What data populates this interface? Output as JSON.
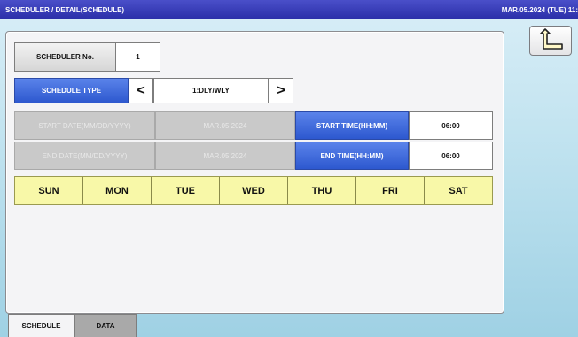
{
  "titlebar": {
    "title": "SCHEDULER / DETAIL(SCHEDULE)",
    "datetime": "MAR.05.2024 (TUE) 11:"
  },
  "scheduler_no": {
    "label": "SCHEDULER No.",
    "value": "1"
  },
  "schedule_type": {
    "label": "SCHEDULE TYPE",
    "prev": "<",
    "value": "1:DLY/WLY",
    "next": ">"
  },
  "start_date": {
    "label": "START DATE(MM/DD/YYYY)",
    "value": "MAR.05.2024"
  },
  "end_date": {
    "label": "END DATE(MM/DD/YYYY)",
    "value": "MAR.05.2024"
  },
  "start_time": {
    "label": "START TIME(HH:MM)",
    "value": "06:00"
  },
  "end_time": {
    "label": "END TIME(HH:MM)",
    "value": "06:00"
  },
  "days": [
    "SUN",
    "MON",
    "TUE",
    "WED",
    "THU",
    "FRI",
    "SAT"
  ],
  "tabs": {
    "schedule": "SCHEDULE",
    "data": "DATA"
  },
  "icons": {
    "back": "return-arrow-icon"
  },
  "colors": {
    "titlebar": "#2a2ea8",
    "accent_blue": "#2d58cf",
    "day_yellow": "#f8f8a8"
  }
}
